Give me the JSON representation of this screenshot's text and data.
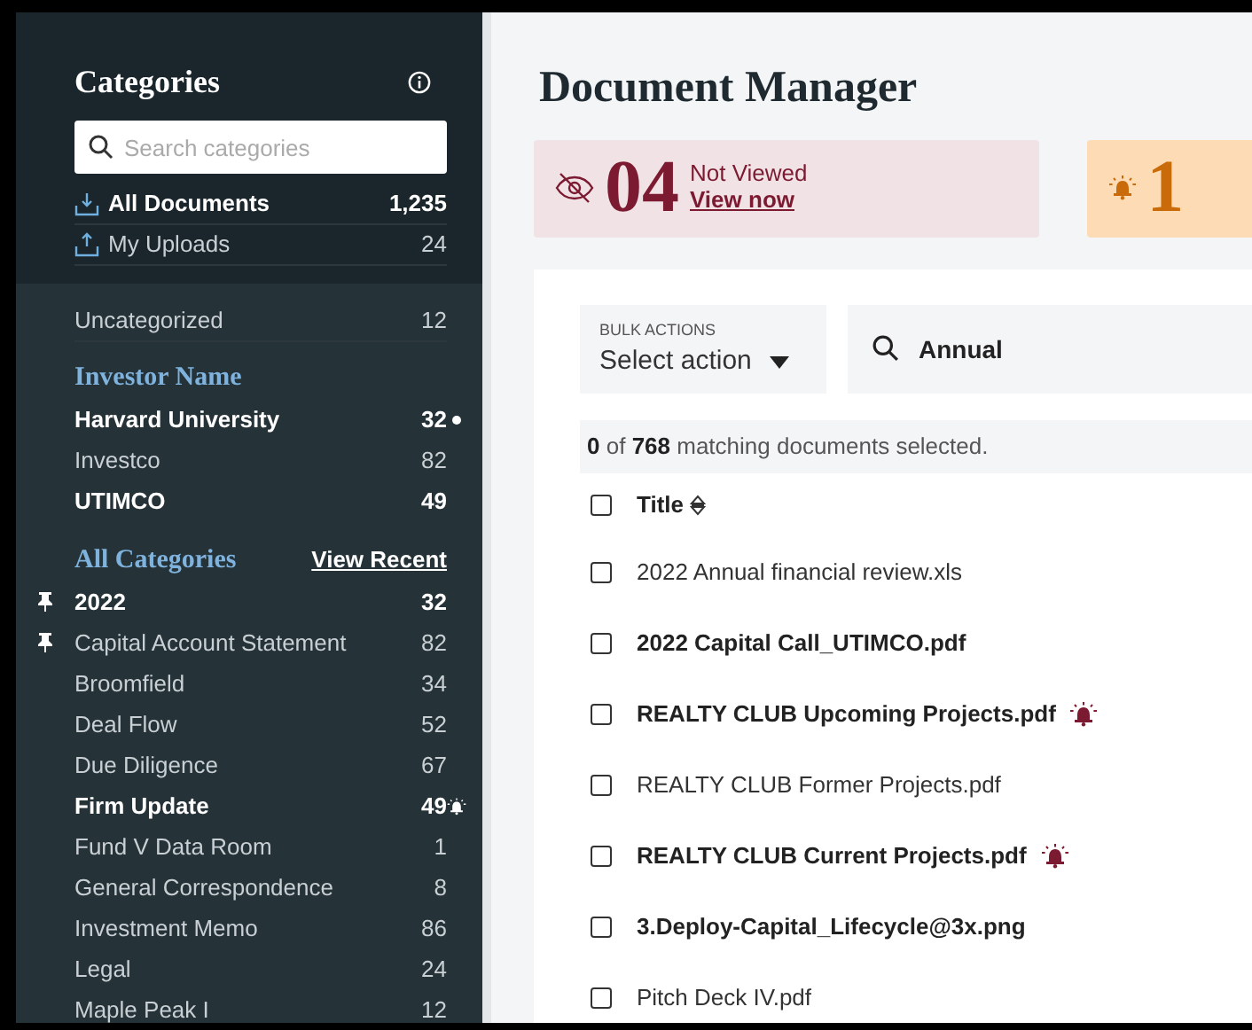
{
  "sidebar": {
    "title": "Categories",
    "search": {
      "placeholder": "Search categories"
    },
    "top_items": [
      {
        "kind": "download",
        "label": "All Documents",
        "count": "1,235",
        "unread": true
      },
      {
        "kind": "upload",
        "label": "My Uploads",
        "count": "24",
        "unread": false
      }
    ],
    "uncategorized": {
      "label": "Uncategorized",
      "count": "12",
      "unread": false
    },
    "investor_heading": "Investor Name",
    "investors": [
      {
        "label": "Harvard University",
        "count": "32",
        "unread": true,
        "unread_dot": true
      },
      {
        "label": "Investco",
        "count": "82",
        "unread": false,
        "unread_dot": false
      },
      {
        "label": "UTIMCO",
        "count": "49",
        "unread": true,
        "unread_dot": false
      }
    ],
    "categories_heading": "All Categories",
    "view_recent": "View Recent",
    "categories": [
      {
        "label": "2022",
        "count": "32",
        "unread": true,
        "pinned": true,
        "alert": false
      },
      {
        "label": "Capital Account Statement",
        "count": "82",
        "unread": false,
        "pinned": true,
        "alert": false
      },
      {
        "label": "Broomfield",
        "count": "34",
        "unread": false,
        "pinned": false,
        "alert": false
      },
      {
        "label": "Deal Flow",
        "count": "52",
        "unread": false,
        "pinned": false,
        "alert": false
      },
      {
        "label": "Due Diligence",
        "count": "67",
        "unread": false,
        "pinned": false,
        "alert": false
      },
      {
        "label": "Firm Update",
        "count": "49",
        "unread": true,
        "pinned": false,
        "alert": true
      },
      {
        "label": "Fund V Data Room",
        "count": "1",
        "unread": false,
        "pinned": false,
        "alert": false
      },
      {
        "label": "General Correspondence",
        "count": "8",
        "unread": false,
        "pinned": false,
        "alert": false
      },
      {
        "label": "Investment Memo",
        "count": "86",
        "unread": false,
        "pinned": false,
        "alert": false
      },
      {
        "label": "Legal",
        "count": "24",
        "unread": false,
        "pinned": false,
        "alert": false
      },
      {
        "label": "Maple Peak I",
        "count": "12",
        "unread": false,
        "pinned": false,
        "alert": false
      }
    ]
  },
  "main": {
    "title": "Document Manager",
    "stats": [
      {
        "kind": "not_viewed",
        "number": "04",
        "label": "Not Viewed",
        "link": "View now"
      },
      {
        "kind": "alerts",
        "number": "1"
      }
    ],
    "bulk_actions": {
      "label": "BULK ACTIONS",
      "value": "Select action"
    },
    "search": {
      "value": "Annual"
    },
    "selection": "**0** of **768** matching documents selected.",
    "table": {
      "header": {
        "label": "Title",
        "checked": false
      },
      "rows": [
        {
          "title": "2022 Annual financial review.xls",
          "unread": false,
          "alert": false,
          "checked": false
        },
        {
          "title": "2022 Capital Call_UTIMCO.pdf",
          "unread": true,
          "alert": false,
          "checked": false
        },
        {
          "title": "REALTY CLUB Upcoming Projects.pdf",
          "unread": true,
          "alert": true,
          "checked": false
        },
        {
          "title": "REALTY CLUB Former Projects.pdf",
          "unread": false,
          "alert": false,
          "checked": false
        },
        {
          "title": "REALTY CLUB Current Projects.pdf",
          "unread": true,
          "alert": true,
          "checked": false
        },
        {
          "title": "3.Deploy-Capital_Lifecycle@3x.png",
          "unread": true,
          "alert": false,
          "checked": false
        },
        {
          "title": "Pitch Deck IV.pdf",
          "unread": false,
          "alert": false,
          "checked": false
        }
      ]
    }
  }
}
